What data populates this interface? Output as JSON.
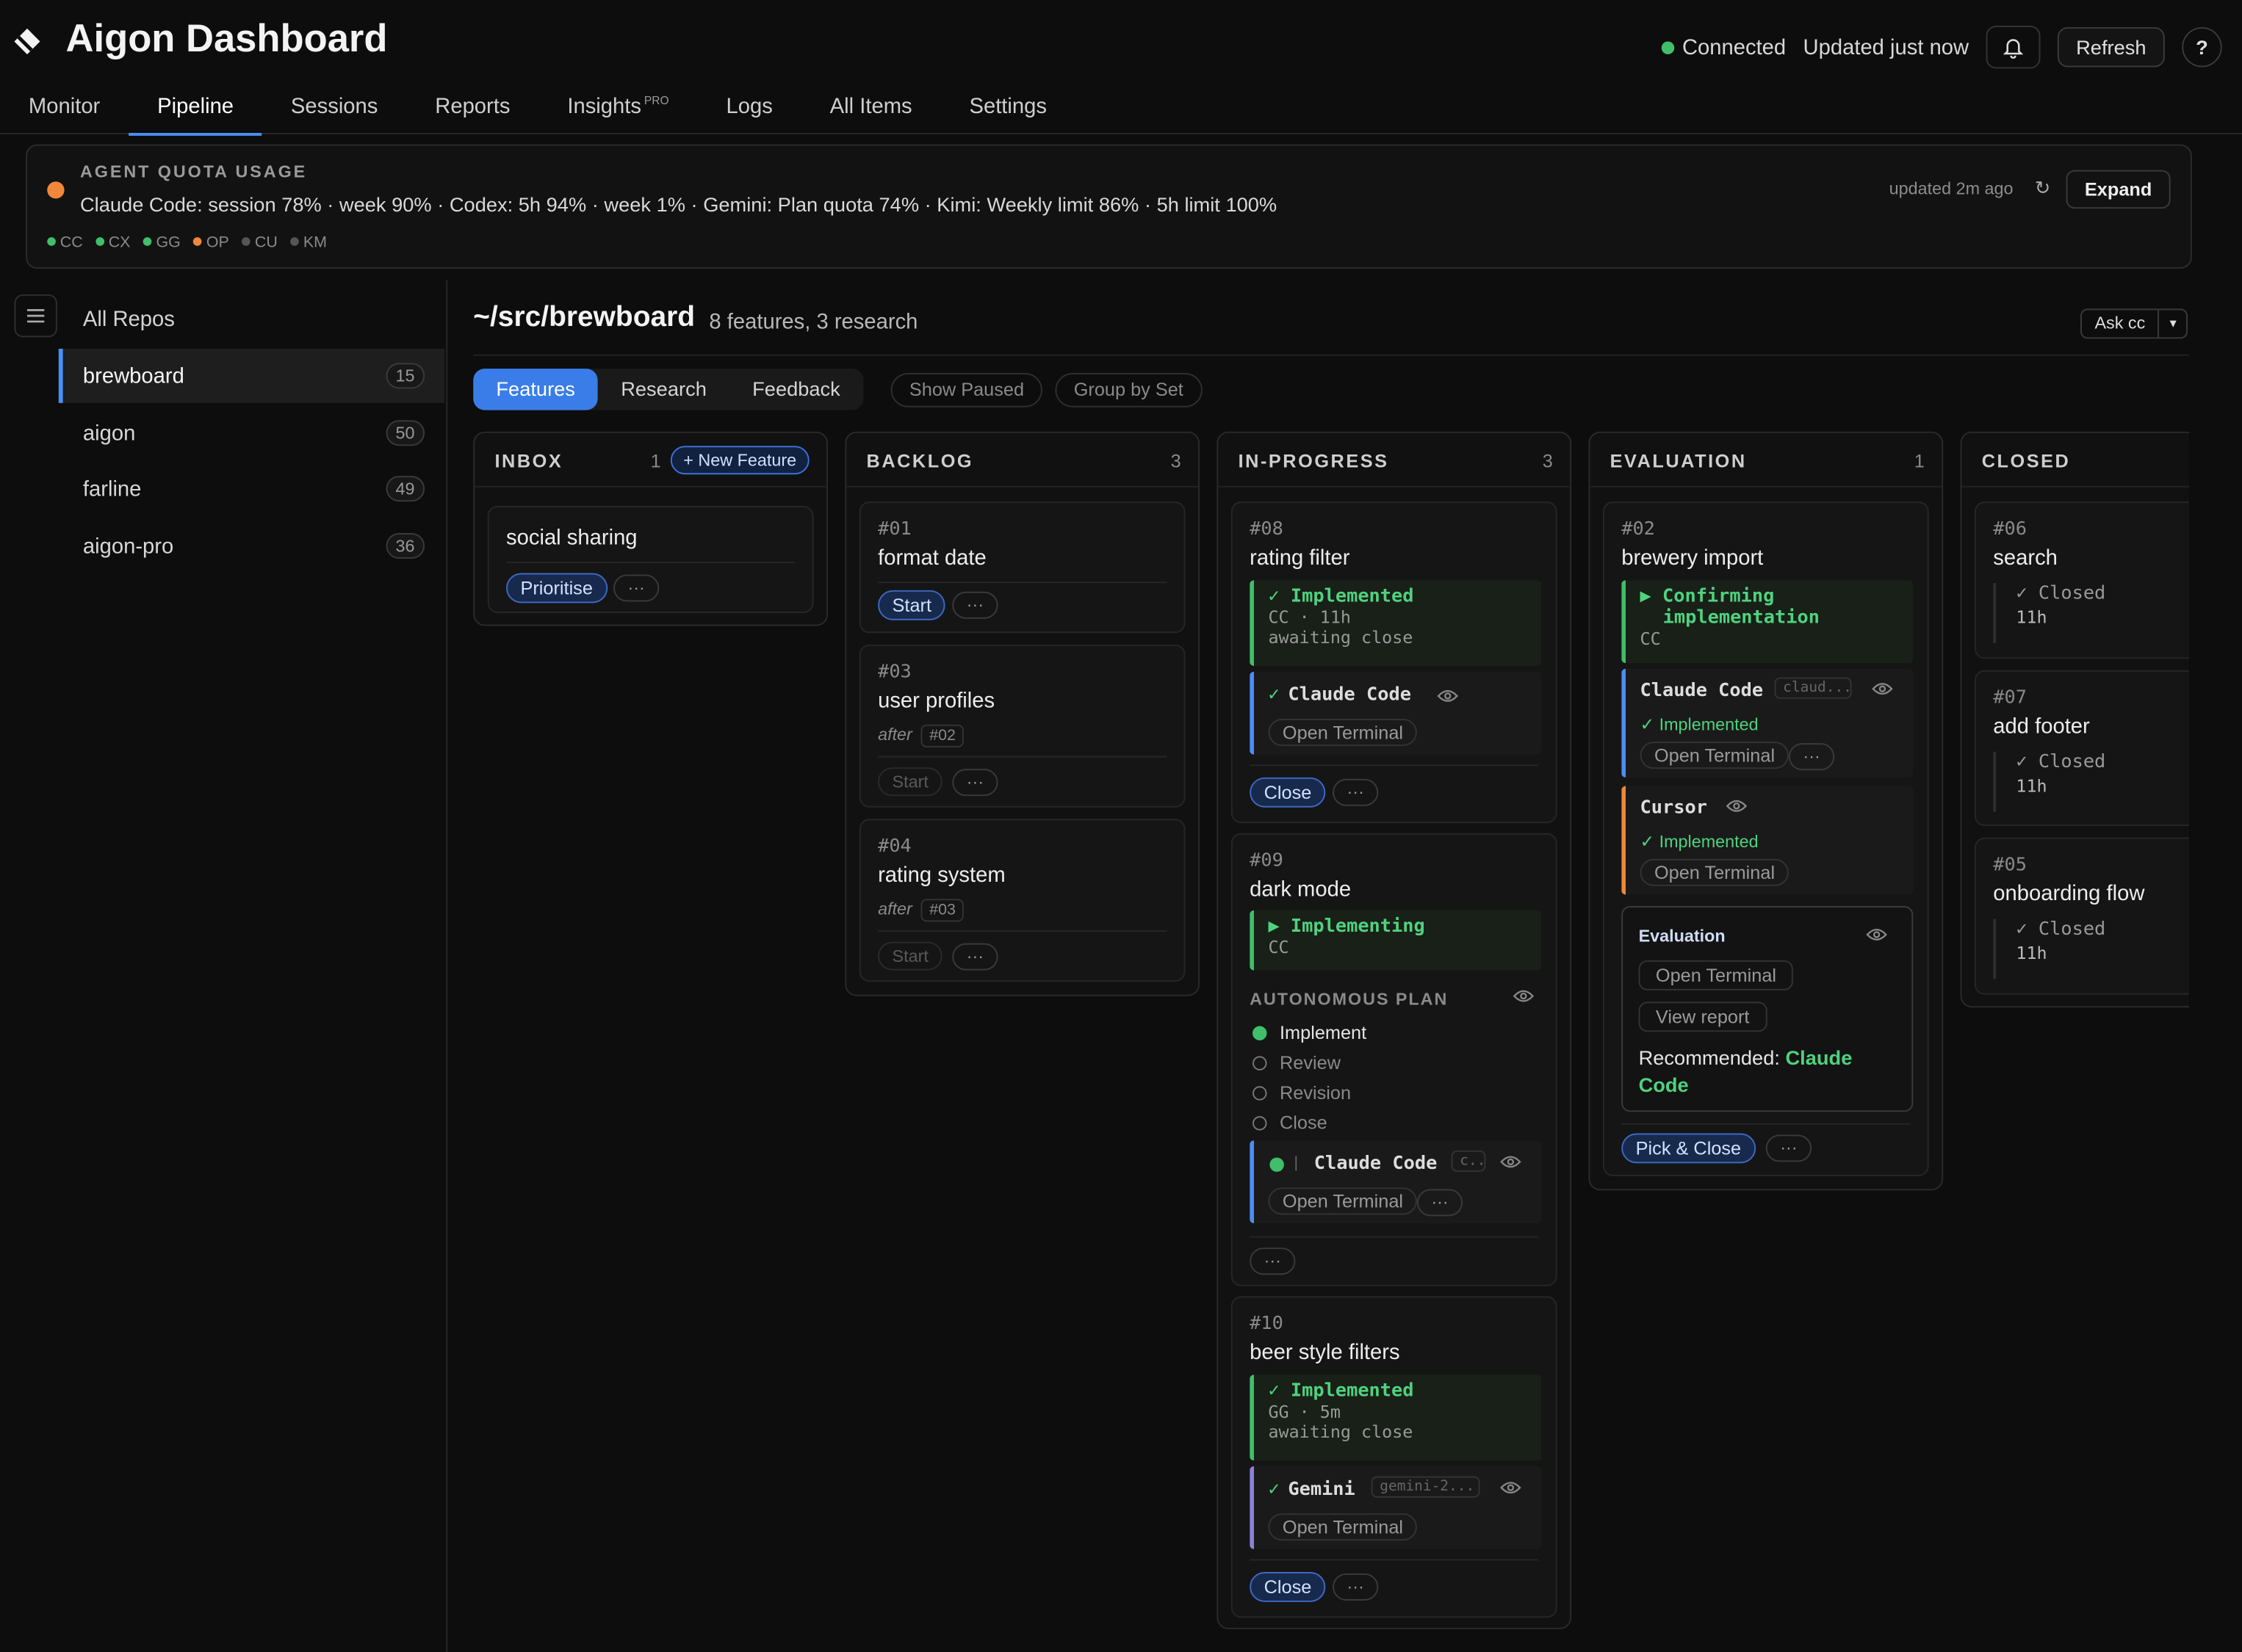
{
  "header": {
    "title": "Aigon Dashboard",
    "status": "Connected",
    "updated": "Updated just now",
    "refresh": "Refresh",
    "help": "?"
  },
  "nav": {
    "items": [
      "Monitor",
      "Pipeline",
      "Sessions",
      "Reports",
      "Insights",
      "Logs",
      "All Items",
      "Settings"
    ],
    "insights_badge": "PRO",
    "active": "Pipeline"
  },
  "quota": {
    "title": "AGENT QUOTA USAGE",
    "text": "Claude Code: session 78% · week 90% · Codex: 5h 94% · week 1% · Gemini: Plan quota 74% · Kimi: Weekly limit 86% · 5h limit 100%",
    "updated": "updated 2m ago",
    "refresh_icon": "↻",
    "expand": "Expand",
    "legend": [
      {
        "label": "CC",
        "color": "#3fbf6a"
      },
      {
        "label": "CX",
        "color": "#3fbf6a"
      },
      {
        "label": "GG",
        "color": "#3fbf6a"
      },
      {
        "label": "OP",
        "color": "#f0873a"
      },
      {
        "label": "CU",
        "color": "#555555"
      },
      {
        "label": "KM",
        "color": "#555555"
      }
    ]
  },
  "sidebar": {
    "all": "All Repos",
    "repos": [
      {
        "name": "brewboard",
        "count": "15"
      },
      {
        "name": "aigon",
        "count": "50"
      },
      {
        "name": "farline",
        "count": "49"
      },
      {
        "name": "aigon-pro",
        "count": "36"
      }
    ]
  },
  "main": {
    "path": "~/src/brewboard",
    "summary": "8 features, 3 research",
    "ask": "Ask cc",
    "tabs": [
      "Features",
      "Research",
      "Feedback"
    ],
    "show_paused": "Show Paused",
    "group_by_set": "Group by Set"
  },
  "columns": {
    "inbox": {
      "title": "INBOX",
      "count": "1",
      "new": "+ New Feature",
      "card": {
        "name": "social sharing",
        "action": "Prioritise"
      }
    },
    "backlog": {
      "title": "BACKLOG",
      "count": "3",
      "cards": [
        {
          "id": "#01",
          "name": "format date",
          "action": "Start"
        },
        {
          "id": "#03",
          "name": "user profiles",
          "after": "after",
          "dep": "#02",
          "action": "Start"
        },
        {
          "id": "#04",
          "name": "rating system",
          "after": "after",
          "dep": "#03",
          "action": "Start"
        }
      ]
    },
    "inprogress": {
      "title": "IN-PROGRESS",
      "count": "3",
      "c08": {
        "id": "#08",
        "name": "rating filter",
        "status": "✓ Implemented",
        "meta": "CC · 11h",
        "note": "awaiting close",
        "agent": "Claude Code",
        "term": "Open Terminal",
        "action": "Close"
      },
      "c09": {
        "id": "#09",
        "name": "dark mode",
        "status": "▶ Implementing",
        "meta": "CC",
        "plan": "AUTONOMOUS PLAN",
        "steps": [
          "Implement",
          "Review",
          "Revision",
          "Close"
        ],
        "agent": "Claude Code",
        "model": "c...",
        "term": "Open Terminal"
      },
      "c10": {
        "id": "#10",
        "name": "beer style filters",
        "status": "✓ Implemented",
        "meta": "GG · 5m",
        "note": "awaiting close",
        "agent": "Gemini",
        "model": "gemini-2...",
        "term": "Open Terminal",
        "action": "Close"
      }
    },
    "evaluation": {
      "title": "EVALUATION",
      "count": "1",
      "id": "#02",
      "name": "brewery import",
      "status1": "▶ Confirming",
      "status2": "implementation",
      "meta": "CC",
      "agent1": "Claude Code",
      "model1": "claud...",
      "impl": "✓ Implemented",
      "term": "Open Terminal",
      "agent2": "Cursor",
      "eval_title": "Evaluation",
      "view_report": "View report",
      "rec_label": "Recommended:",
      "rec_agent": "Claude Code",
      "action": "Pick & Close"
    },
    "closed": {
      "title": "CLOSED",
      "cards": [
        {
          "id": "#06",
          "name": "search",
          "status": "✓ Closed",
          "time": "11h"
        },
        {
          "id": "#07",
          "name": "add footer",
          "status": "✓ Closed",
          "time": "11h"
        },
        {
          "id": "#05",
          "name": "onboarding flow",
          "status": "✓ Closed",
          "time": "11h"
        }
      ]
    }
  },
  "ui": {
    "dots": "···"
  },
  "colors": {
    "accent": "#3a7de8",
    "success": "#3fbf6a",
    "warning": "#f0873a"
  }
}
